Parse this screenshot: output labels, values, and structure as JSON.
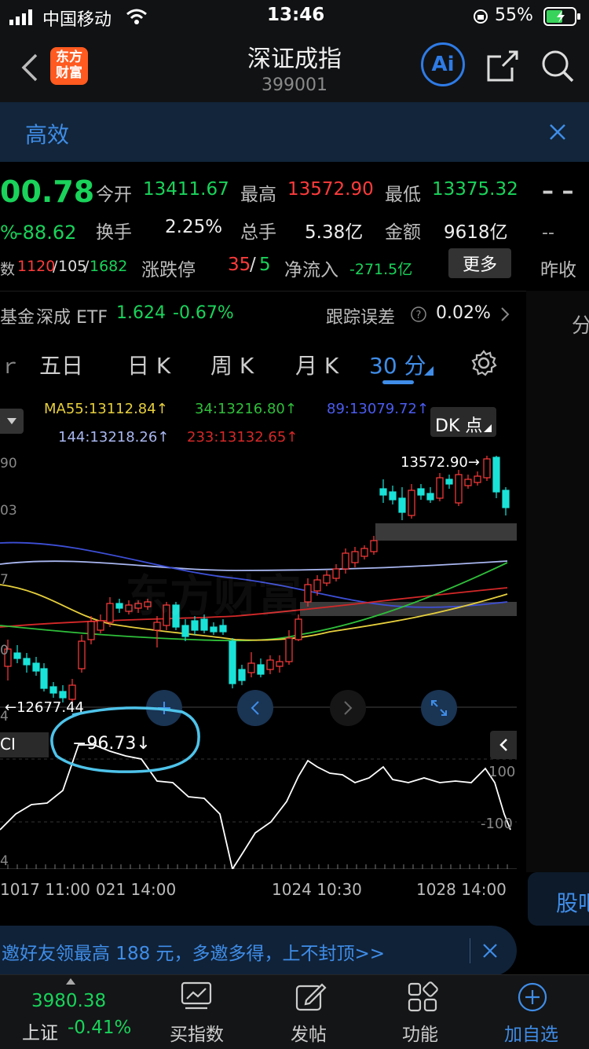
{
  "status": {
    "carrier": "中国移动",
    "time": "13:46",
    "battery": "55%"
  },
  "nav": {
    "logo_line1": "东方",
    "logo_line2": "财富",
    "title": "深证成指",
    "code": "399001",
    "ai_label": "Ai"
  },
  "banner": {
    "text": "高效"
  },
  "quote": {
    "price": "00.78",
    "change_pct": "%",
    "change": "-88.62",
    "open_label": "今开",
    "open": "13411.67",
    "high_label": "最高",
    "high": "13572.90",
    "low_label": "最低",
    "low": "13375.32",
    "turnover_label": "换手",
    "turnover": "2.25%",
    "volume_label": "总手",
    "volume": "5.38亿",
    "amount_label": "金额",
    "amount": "9618亿",
    "breadth_label": "数",
    "breadth_up": "1120",
    "breadth_flat": "105",
    "breadth_down": "1682",
    "limit_label": "涨跌停",
    "limit_up": "35",
    "limit_down": "5",
    "netflow_label": "净流入",
    "netflow": "-271.5亿",
    "more_button": "更多",
    "right_dash1": "– –",
    "right_dash2": "--",
    "prev_close_label": "昨收"
  },
  "etf": {
    "prefix": "基金",
    "name": "深成 ETF",
    "price": "1.624",
    "change": "-0.67%",
    "tracking_label": "跟踪误差",
    "tracking_value": "0.02%"
  },
  "right_col": {
    "top_char": "分",
    "bottom_label": "股吧"
  },
  "tabs": [
    {
      "label": "五日",
      "active": false
    },
    {
      "label": "日 K",
      "active": false
    },
    {
      "label": "周 K",
      "active": false
    },
    {
      "label": "月 K",
      "active": false
    },
    {
      "label": "30 分",
      "active": true
    }
  ],
  "ma": {
    "ma55": "MA55:13112.84↑",
    "ma34": "34:13216.80↑",
    "ma89": "89:13079.72↑",
    "ma144": "144:13218.26↑",
    "ma233": "233:13132.65↑",
    "dk_button": "DK 点"
  },
  "chart": {
    "y_labels": [
      "90",
      "03",
      "7",
      "0",
      "4"
    ],
    "high_marker": "13572.90→",
    "low_marker": "←12677.44",
    "indicator_name": "CI",
    "indicator_value": "−96.73↓",
    "cci_100": "100",
    "cci_neg100": "-100",
    "cci_bottom_label": "4",
    "x_labels": [
      "1017 11:00",
      "021 14:00",
      "1024 10:30",
      "1028 14:00"
    ],
    "colors": {
      "up": "#ff3b3b",
      "down": "#19e3d8",
      "ma55": "#e6cf3c",
      "ma34": "#2fbf3a",
      "ma89": "#3d4fd6",
      "ma144": "#a9b7f0",
      "ma233": "#d42828"
    }
  },
  "ad": {
    "text": "邀好友领最高 188 元，多邀多得，上不封顶>>"
  },
  "tabbar": {
    "index_value": "3980.38",
    "index_name": "上证",
    "index_change": "-0.41%",
    "items": [
      "买指数",
      "发帖",
      "功能",
      "加自选"
    ]
  }
}
